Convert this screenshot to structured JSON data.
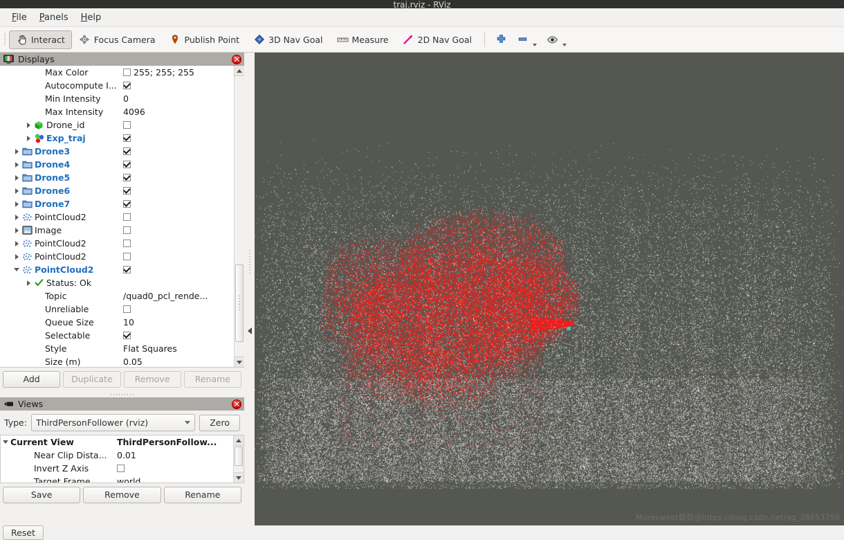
{
  "window": {
    "title": "traj.rviz - RViz"
  },
  "menubar": [
    {
      "name": "file",
      "accel": "F",
      "rest": "ile"
    },
    {
      "name": "panels",
      "accel": "P",
      "rest": "anels"
    },
    {
      "name": "help",
      "accel": "H",
      "rest": "elp"
    }
  ],
  "toolbar": {
    "tools": [
      {
        "label": "Interact",
        "icon": "hand-cursor-icon",
        "active": true
      },
      {
        "label": "Focus Camera",
        "icon": "focus-camera-icon",
        "active": false
      },
      {
        "label": "Publish Point",
        "icon": "map-pin-icon",
        "active": false
      },
      {
        "label": "3D Nav Goal",
        "icon": "diamond-icon",
        "active": false
      },
      {
        "label": "Measure",
        "icon": "ruler-icon",
        "active": false
      },
      {
        "label": "2D Nav Goal",
        "icon": "magenta-arrow-icon",
        "active": false
      }
    ],
    "zoom_in": "zoom-in-icon",
    "zoom_out": "zoom-out-icon",
    "focus": "eye-icon"
  },
  "displays": {
    "panel_title": "Displays",
    "rows": [
      {
        "indent": 3,
        "arrow": "none",
        "icon": "none",
        "label": "Max Color",
        "bold": false,
        "value_type": "color",
        "value": "255; 255; 255"
      },
      {
        "indent": 3,
        "arrow": "none",
        "icon": "none",
        "label": "Autocompute I...",
        "bold": false,
        "value_type": "check_on",
        "value": ""
      },
      {
        "indent": 3,
        "arrow": "none",
        "icon": "none",
        "label": "Min Intensity",
        "bold": false,
        "value_type": "text",
        "value": "0"
      },
      {
        "indent": 3,
        "arrow": "none",
        "icon": "none",
        "label": "Max Intensity",
        "bold": false,
        "value_type": "text",
        "value": "4096"
      },
      {
        "indent": 2,
        "arrow": "right",
        "icon": "green-cube-icon",
        "label": "Drone_id",
        "bold": false,
        "value_type": "check_off",
        "value": ""
      },
      {
        "indent": 2,
        "arrow": "right",
        "icon": "spheres-icon",
        "label": "Exp_traj",
        "bold": true,
        "value_type": "check_on",
        "value": ""
      },
      {
        "indent": 1,
        "arrow": "right",
        "icon": "folder-icon",
        "label": "Drone3",
        "bold": true,
        "value_type": "check_on",
        "value": ""
      },
      {
        "indent": 1,
        "arrow": "right",
        "icon": "folder-icon",
        "label": "Drone4",
        "bold": true,
        "value_type": "check_on",
        "value": ""
      },
      {
        "indent": 1,
        "arrow": "right",
        "icon": "folder-icon",
        "label": "Drone5",
        "bold": true,
        "value_type": "check_on",
        "value": ""
      },
      {
        "indent": 1,
        "arrow": "right",
        "icon": "folder-icon",
        "label": "Drone6",
        "bold": true,
        "value_type": "check_on",
        "value": ""
      },
      {
        "indent": 1,
        "arrow": "right",
        "icon": "folder-icon",
        "label": "Drone7",
        "bold": true,
        "value_type": "check_on",
        "value": ""
      },
      {
        "indent": 1,
        "arrow": "right",
        "icon": "pointcloud-icon",
        "label": "PointCloud2",
        "bold": false,
        "value_type": "check_off",
        "value": ""
      },
      {
        "indent": 1,
        "arrow": "right",
        "icon": "image-icon",
        "label": "Image",
        "bold": false,
        "value_type": "check_off",
        "value": ""
      },
      {
        "indent": 1,
        "arrow": "right",
        "icon": "pointcloud-icon",
        "label": "PointCloud2",
        "bold": false,
        "value_type": "check_off",
        "value": ""
      },
      {
        "indent": 1,
        "arrow": "right",
        "icon": "pointcloud-icon",
        "label": "PointCloud2",
        "bold": false,
        "value_type": "check_off",
        "value": ""
      },
      {
        "indent": 1,
        "arrow": "down",
        "icon": "pointcloud-icon",
        "label": "PointCloud2",
        "bold": true,
        "value_type": "check_on",
        "value": ""
      },
      {
        "indent": 2,
        "arrow": "right",
        "icon": "status-ok-icon",
        "label": "Status: Ok",
        "bold": false,
        "value_type": "none",
        "value": ""
      },
      {
        "indent": 3,
        "arrow": "none",
        "icon": "none",
        "label": "Topic",
        "bold": false,
        "value_type": "text",
        "value": "/quad0_pcl_rende..."
      },
      {
        "indent": 3,
        "arrow": "none",
        "icon": "none",
        "label": "Unreliable",
        "bold": false,
        "value_type": "check_off",
        "value": ""
      },
      {
        "indent": 3,
        "arrow": "none",
        "icon": "none",
        "label": "Queue Size",
        "bold": false,
        "value_type": "text",
        "value": "10"
      },
      {
        "indent": 3,
        "arrow": "none",
        "icon": "none",
        "label": "Selectable",
        "bold": false,
        "value_type": "check_on",
        "value": ""
      },
      {
        "indent": 3,
        "arrow": "none",
        "icon": "none",
        "label": "Style",
        "bold": false,
        "value_type": "text",
        "value": "Flat Squares"
      },
      {
        "indent": 3,
        "arrow": "none",
        "icon": "none",
        "label": "Size (m)",
        "bold": false,
        "value_type": "text",
        "value": "0.05"
      }
    ],
    "buttons": [
      {
        "label": "Add",
        "enabled": true
      },
      {
        "label": "Duplicate",
        "enabled": false
      },
      {
        "label": "Remove",
        "enabled": false
      },
      {
        "label": "Rename",
        "enabled": false
      }
    ]
  },
  "views": {
    "panel_title": "Views",
    "type_label": "Type:",
    "type_value": "ThirdPersonFollower (rviz)",
    "zero_button": "Zero",
    "rows": [
      {
        "indent": 0,
        "arrow": "down",
        "label": "Current View",
        "bold": true,
        "value_type": "text",
        "value": "ThirdPersonFollow..."
      },
      {
        "indent": 2,
        "arrow": "none",
        "label": "Near Clip Dista...",
        "bold": false,
        "value_type": "text",
        "value": "0.01"
      },
      {
        "indent": 2,
        "arrow": "none",
        "label": "Invert Z Axis",
        "bold": false,
        "value_type": "check_off",
        "value": ""
      },
      {
        "indent": 2,
        "arrow": "none",
        "label": "Target Frame",
        "bold": false,
        "value_type": "text",
        "value": "world"
      }
    ],
    "buttons": [
      {
        "label": "Save",
        "enabled": true
      },
      {
        "label": "Remove",
        "enabled": true
      },
      {
        "label": "Rename",
        "enabled": true
      }
    ]
  },
  "render_view": {
    "background_color": "#555751",
    "point_colors": {
      "map": "#d9d9d9",
      "trajectory": "#ff1818",
      "marker": "#22d3e0"
    },
    "watermark": "Moresweet茹茹@https://blog.csdn.net/qq_38853759"
  },
  "statusbar": {
    "reset_label": "Reset"
  }
}
